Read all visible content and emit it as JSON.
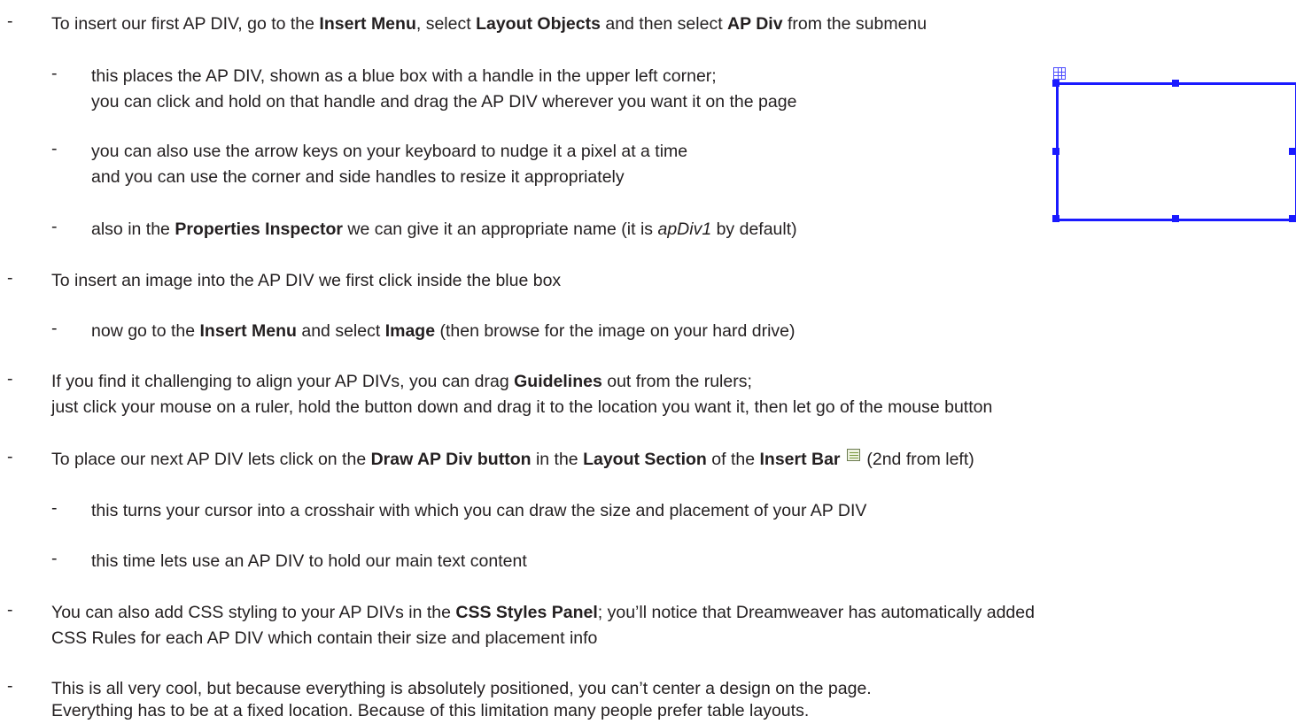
{
  "dash": "-",
  "b1": {
    "a": "To insert our first AP DIV, go to the ",
    "b": "Insert Menu",
    "c": ", select ",
    "d": "Layout Objects",
    "e": " and then select ",
    "f": "AP Div",
    "g": " from the submenu"
  },
  "b2": {
    "l1": "this places the AP DIV, shown as a blue box with a handle in the upper left corner;",
    "l2": "you can click and hold on that handle and drag the AP DIV wherever you want it on the page"
  },
  "b3": {
    "l1": "you can also use the arrow keys on your keyboard to nudge it a pixel at a time",
    "l2": "and you can use the corner and side handles to resize it appropriately"
  },
  "b4": {
    "a": "also in the ",
    "b": "Properties Inspector",
    "c": " we can give it an appropriate name (it is ",
    "d": "apDiv1",
    "e": " by default)"
  },
  "b5": {
    "a": "To insert an image into the AP DIV we first click inside the blue box"
  },
  "b6": {
    "a": "now go to the ",
    "b": "Insert Menu",
    "c": " and select ",
    "d": "Image",
    "e": " (then browse for the image on your hard drive)"
  },
  "b7": {
    "a": "If you find it challenging to align your AP DIVs, you can drag ",
    "b": "Guidelines",
    "c": " out from the rulers;",
    "l2": "just click your mouse on a ruler, hold the button down and drag it to the location you want it, then let go of the mouse button"
  },
  "b8": {
    "a": "To place our next AP DIV lets click on the ",
    "b": "Draw AP Div button",
    "c": " in the ",
    "d": "Layout Section",
    "e": " of the ",
    "f": "Insert Bar",
    "g": " (2nd from left)",
    "icon": "draw-ap-div-icon"
  },
  "b9": {
    "a": "this turns your cursor into a crosshair with which you can draw the size and placement of your AP DIV"
  },
  "b10": {
    "a": "this time lets use an AP DIV to hold our main text content"
  },
  "b11": {
    "a": "You can also add CSS styling to your AP DIVs in the ",
    "b": "CSS Styles Panel",
    "c": "; you’ll notice that Dreamweaver has automatically added",
    "l2": "CSS Rules for each AP DIV which contain their size and placement info"
  },
  "b12": {
    "l1": "This is all very cool, but because everything is absolutely positioned, you can’t center a design on the page.",
    "l2": "Everything has to be at a fixed location. Because of this limitation many people prefer table layouts."
  },
  "illustration": {
    "border_color": "#1a1aff",
    "handle_icon": "ap-div-move-handle-icon"
  }
}
